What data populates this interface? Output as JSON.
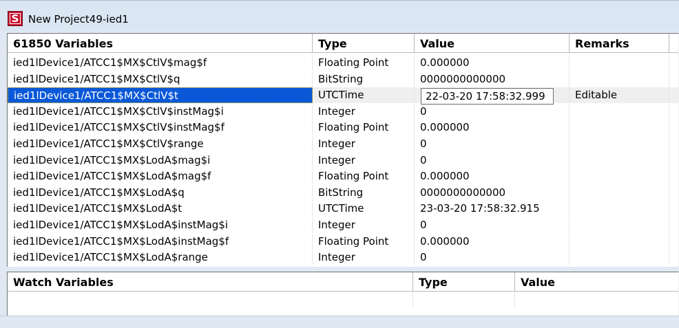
{
  "window": {
    "title": "New Project49-ied1",
    "app_icon_glyph": "S"
  },
  "variables_table": {
    "headers": [
      "61850 Variables",
      "Type",
      "Value",
      "Remarks"
    ],
    "rows": [
      {
        "name": "ied1lDevice1/ATCC1$MX$CtlV$mag$f",
        "type": "Floating Point",
        "value": "0.000000",
        "remarks": ""
      },
      {
        "name": "ied1lDevice1/ATCC1$MX$CtlV$q",
        "type": "BitString",
        "value": "0000000000000",
        "remarks": ""
      },
      {
        "name": "ied1lDevice1/ATCC1$MX$CtlV$t",
        "type": "UTCTime",
        "value": "22-03-20 17:58:32.999",
        "remarks": "Editable",
        "selected": true,
        "editing": true
      },
      {
        "name": "ied1lDevice1/ATCC1$MX$CtlV$instMag$i",
        "type": "Integer",
        "value": "0",
        "remarks": ""
      },
      {
        "name": "ied1lDevice1/ATCC1$MX$CtlV$instMag$f",
        "type": "Floating Point",
        "value": "0.000000",
        "remarks": ""
      },
      {
        "name": "ied1lDevice1/ATCC1$MX$CtlV$range",
        "type": "Integer",
        "value": "0",
        "remarks": ""
      },
      {
        "name": "ied1lDevice1/ATCC1$MX$LodA$mag$i",
        "type": "Integer",
        "value": "0",
        "remarks": ""
      },
      {
        "name": "ied1lDevice1/ATCC1$MX$LodA$mag$f",
        "type": "Floating Point",
        "value": "0.000000",
        "remarks": ""
      },
      {
        "name": "ied1lDevice1/ATCC1$MX$LodA$q",
        "type": "BitString",
        "value": "0000000000000",
        "remarks": ""
      },
      {
        "name": "ied1lDevice1/ATCC1$MX$LodA$t",
        "type": "UTCTime",
        "value": "23-03-20 17:58:32.915",
        "remarks": ""
      },
      {
        "name": "ied1lDevice1/ATCC1$MX$LodA$instMag$i",
        "type": "Integer",
        "value": "0",
        "remarks": ""
      },
      {
        "name": "ied1lDevice1/ATCC1$MX$LodA$instMag$f",
        "type": "Floating Point",
        "value": "0.000000",
        "remarks": ""
      },
      {
        "name": "ied1lDevice1/ATCC1$MX$LodA$range",
        "type": "Integer",
        "value": "0",
        "remarks": ""
      }
    ]
  },
  "watch_table": {
    "headers": [
      "Watch Variables",
      "Type",
      "Value"
    ],
    "rows": []
  },
  "colors": {
    "selection": "#0a58d8",
    "window_frame": "#dfe8f3",
    "app_icon": "#c8102e"
  }
}
